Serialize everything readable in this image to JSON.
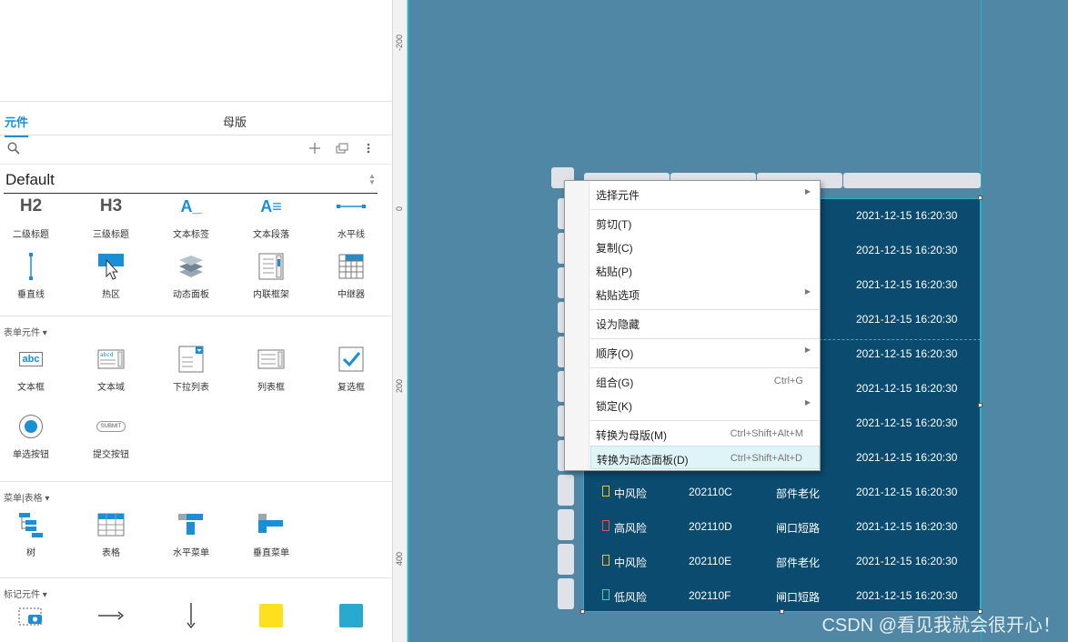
{
  "left_panel": {
    "tabs": {
      "widgets": "元件",
      "masters": "母版"
    },
    "library": {
      "name": "Default"
    },
    "rows": {
      "r1": [
        {
          "glyph": "H2",
          "label": "二级标题"
        },
        {
          "glyph": "H3",
          "label": "三级标题"
        },
        {
          "glyph": "A_",
          "label": "文本标签"
        },
        {
          "glyph": "A≡",
          "label": "文本段落"
        },
        {
          "glyph": "",
          "label": "水平线"
        }
      ],
      "r2": [
        {
          "label": "垂直线"
        },
        {
          "label": "热区"
        },
        {
          "label": "动态面板"
        },
        {
          "label": "内联框架"
        },
        {
          "label": "中继器"
        }
      ],
      "form_title": "表单元件 ▾",
      "r3": [
        {
          "glyph": "abc",
          "label": "文本框"
        },
        {
          "glyph": "abcd",
          "label": "文本域"
        },
        {
          "label": "下拉列表"
        },
        {
          "label": "列表框"
        },
        {
          "label": "复选框"
        }
      ],
      "r4": [
        {
          "label": "单选按钮"
        },
        {
          "glyph": "SUBMIT",
          "label": "提交按钮"
        }
      ],
      "menu_title": "菜单|表格 ▾",
      "r5": [
        {
          "label": "树"
        },
        {
          "label": "表格"
        },
        {
          "label": "水平菜单"
        },
        {
          "label": "垂直菜单"
        }
      ],
      "markup_title": "标记元件 ▾"
    }
  },
  "ruler": {
    "ticks": [
      "-200",
      "0",
      "200",
      "400"
    ]
  },
  "table": {
    "timestamp_rows": [
      "2021-12-15 16:20:30",
      "2021-12-15 16:20:30",
      "2021-12-15 16:20:30",
      "2021-12-15 16:20:30",
      "2021-12-15 16:20:30",
      "2021-12-15 16:20:30",
      "2021-12-15 16:20:30",
      "2021-12-15 16:20:30"
    ],
    "rows": [
      {
        "risk": "中风险",
        "code": "202110C",
        "issue": "部件老化",
        "time": "2021-12-15 16:20:30",
        "color": "#f5c518"
      },
      {
        "risk": "高风险",
        "code": "202110D",
        "issue": "闸口短路",
        "time": "2021-12-15 16:20:30",
        "color": "#e8574a"
      },
      {
        "risk": "中风险",
        "code": "202110E",
        "issue": "部件老化",
        "time": "2021-12-15 16:20:30",
        "color": "#f5c518"
      },
      {
        "risk": "低风险",
        "code": "202110F",
        "issue": "闸口短路",
        "time": "2021-12-15 16:20:30",
        "color": "#3fd1a8"
      }
    ]
  },
  "context_menu": {
    "select_widgets": "选择元件",
    "cut": "剪切(T)",
    "copy": "复制(C)",
    "paste": "粘贴(P)",
    "paste_options": "粘贴选项",
    "set_hidden": "设为隐藏",
    "order": "顺序(O)",
    "group": "组合(G)",
    "group_shortcut": "Ctrl+G",
    "lock": "锁定(K)",
    "convert_master": "转换为母版(M)",
    "convert_master_shortcut": "Ctrl+Shift+Alt+M",
    "convert_panel": "转换为动态面板(D)",
    "convert_panel_shortcut": "Ctrl+Shift+Alt+D",
    "submenu_arrow": "▶"
  },
  "watermark": "CSDN @看见我就会很开心！",
  "colors": {
    "canvas": "#4f87a5",
    "table": "#0b4b6f",
    "accent": "#1a8fd6",
    "highlight": "#dff4f6"
  }
}
